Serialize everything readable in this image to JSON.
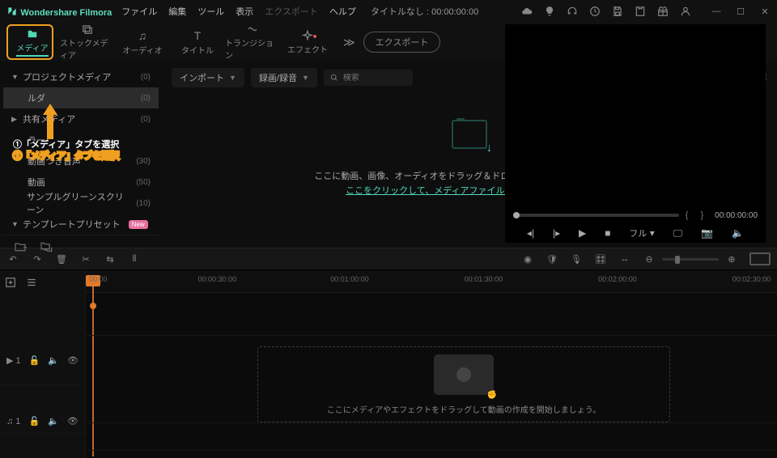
{
  "app": {
    "name": "Wondershare Filmora",
    "project": "タイトルなし : 00:00:00:00"
  },
  "menu": {
    "file": "ファイル",
    "edit": "編集",
    "tool": "ツール",
    "view": "表示",
    "export": "エクスポート",
    "help": "ヘルプ"
  },
  "tabs": {
    "media": "メディア",
    "stock": "ストックメディア",
    "audio": "オーディオ",
    "title": "タイトル",
    "transition": "トランジション",
    "effect": "エフェクト",
    "more": "≫",
    "export": "エクスポート"
  },
  "sidebar": {
    "items": [
      {
        "label": "プロジェクトメディア",
        "count": "(0)"
      },
      {
        "label": "ルダ",
        "count": "(0)"
      },
      {
        "label": "共有メディア",
        "count": "(0)"
      },
      {
        "label": "ラー"
      },
      {
        "label": "動画つき音声",
        "count": "(30)"
      },
      {
        "label": "動画",
        "count": "(50)"
      },
      {
        "label": "サンプルグリーンスクリーン",
        "count": "(10)"
      },
      {
        "label": "テンプレートプリセット",
        "badge": "New"
      }
    ]
  },
  "content": {
    "import": "インポート",
    "record": "録画/録音",
    "search": "検索",
    "drop1": "ここに動画、画像、オーディオをドラッグ＆ドロップしてください。または、",
    "drop2": "ここをクリックして、メディアファイルを追加してください。"
  },
  "player": {
    "timecode": "00:00:00:00",
    "full": "フル"
  },
  "ruler": {
    "t0": "00:00",
    "t1": "00:00:30:00",
    "t2": "00:01:00:00",
    "t3": "00:01:30:00",
    "t4": "00:02:00:00",
    "t5": "00:02:30:00"
  },
  "tracks": {
    "video": "■ 1",
    "audio": "♫ 1",
    "lock": "🔓",
    "mute": "🔈",
    "eye": "👁"
  },
  "timeline": {
    "placeholder": "ここにメディアやエフェクトをドラッグして動画の作成を開始しましょう。"
  },
  "annotation": {
    "text": "①「メディア」タブを選択"
  }
}
